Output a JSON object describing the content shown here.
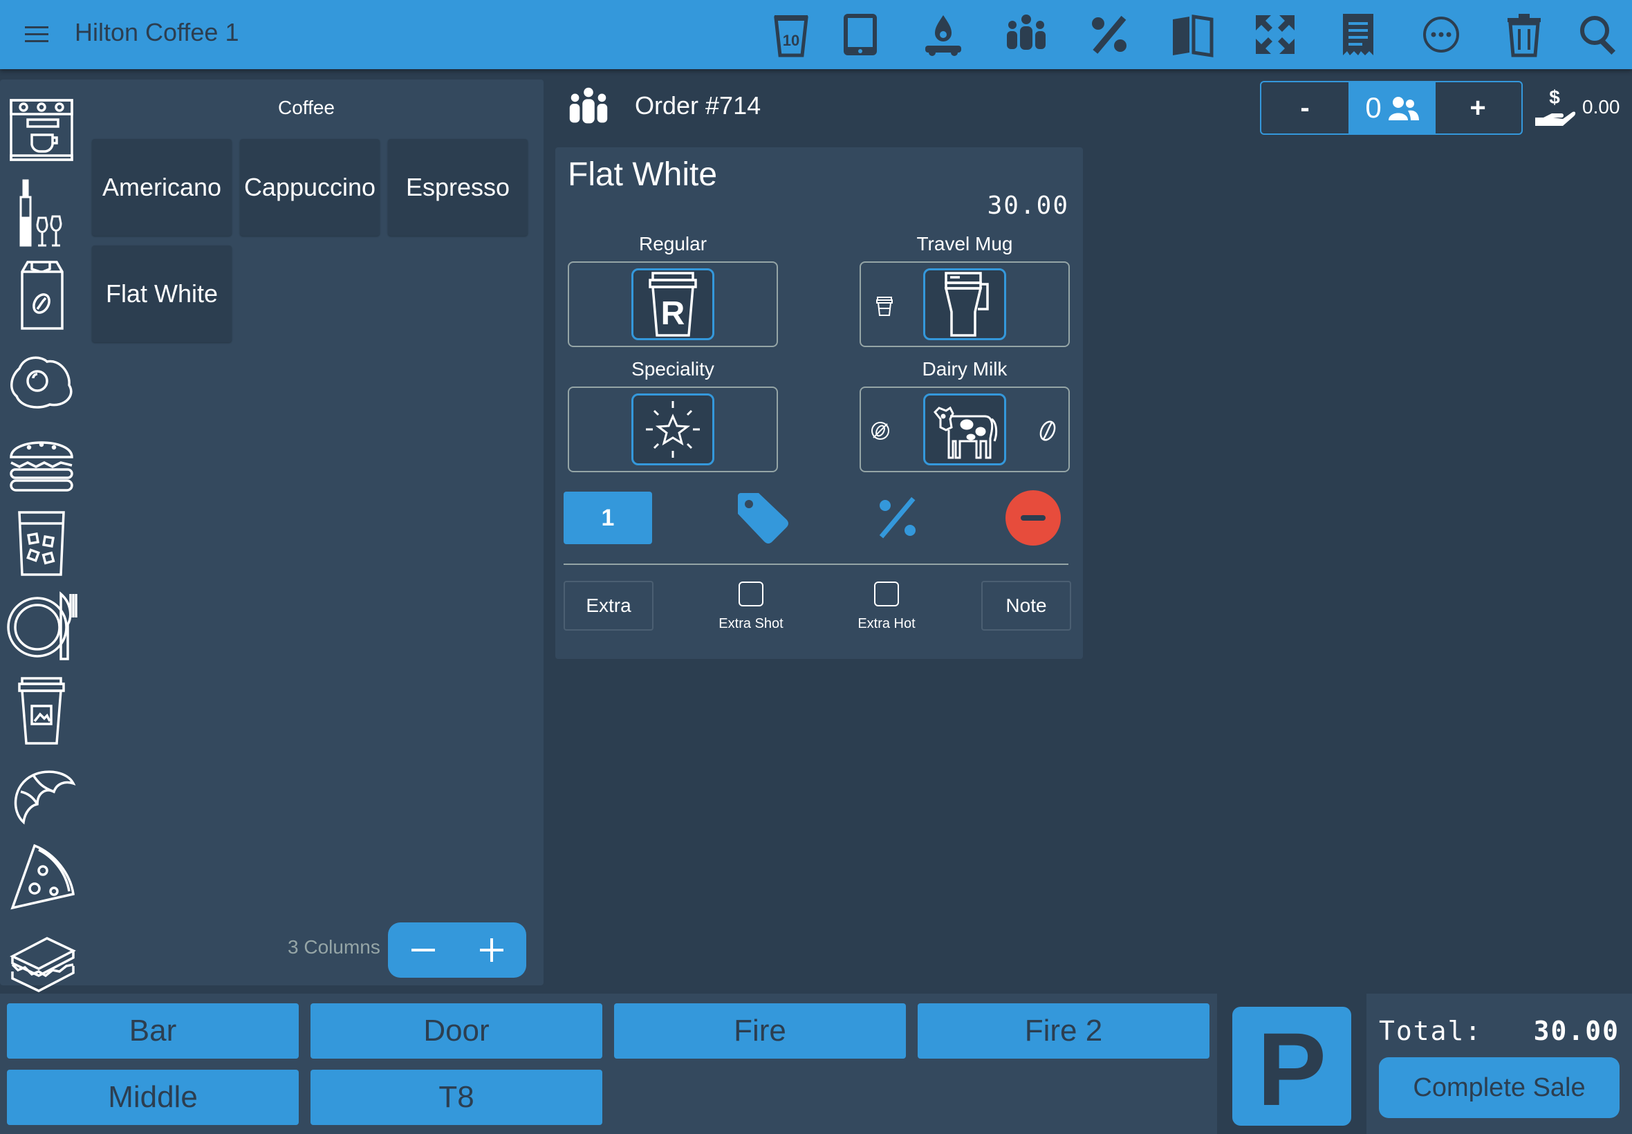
{
  "header": {
    "title": "Hilton Coffee 1",
    "menu_icon": "hamburger-menu-icon",
    "toolbar_icons": [
      "cup-10-icon",
      "tablet-icon",
      "delivery-icon",
      "customers-icon",
      "percent-icon",
      "book-icon",
      "fullscreen-icon",
      "receipt-icon",
      "more-icon",
      "trash-icon",
      "search-icon"
    ],
    "cup_badge": "10"
  },
  "categories": [
    "coffee-machine-icon",
    "wine-icon",
    "coffee-bag-icon",
    "egg-icon",
    "burger-icon",
    "iced-drink-icon",
    "plate-cutlery-icon",
    "takeaway-cup-icon",
    "croissant-icon",
    "pizza-icon",
    "sandwich-icon"
  ],
  "products": {
    "title": "Coffee",
    "items": [
      "Americano",
      "Cappuccino",
      "Espresso",
      "Flat White"
    ],
    "columns_label": "3 Columns",
    "minus": "−",
    "plus": "+"
  },
  "order": {
    "title": "Order #714",
    "guest_minus": "-",
    "guest_count": "0",
    "guest_plus": "+",
    "tip": "0.00"
  },
  "item": {
    "name": "Flat White",
    "price": "30.00",
    "options": [
      {
        "label": "Regular",
        "selected_icon": "regular-cup-icon"
      },
      {
        "label": "Travel Mug",
        "selected_icon": "travel-mug-icon",
        "alt_icon": "small-cup-icon"
      },
      {
        "label": "Speciality",
        "selected_icon": "star-icon"
      },
      {
        "label": "Dairy Milk",
        "selected_icon": "cow-icon",
        "alt_icons": [
          "no-bean-icon",
          "bean-icon"
        ]
      }
    ],
    "quantity": "1",
    "extra_label": "Extra",
    "checkboxes": [
      {
        "label": "Extra Shot",
        "checked": false
      },
      {
        "label": "Extra Hot",
        "checked": false
      }
    ],
    "note_label": "Note"
  },
  "tables": [
    "Bar",
    "Door",
    "Fire",
    "Fire 2",
    "Middle",
    "T8"
  ],
  "parking_label": "P",
  "total": {
    "label": "Total:",
    "value": "30.00",
    "complete_label": "Complete Sale"
  },
  "colors": {
    "accent": "#3498db",
    "background": "#2c3e50",
    "panel": "#34495e",
    "danger": "#e74c3c"
  }
}
